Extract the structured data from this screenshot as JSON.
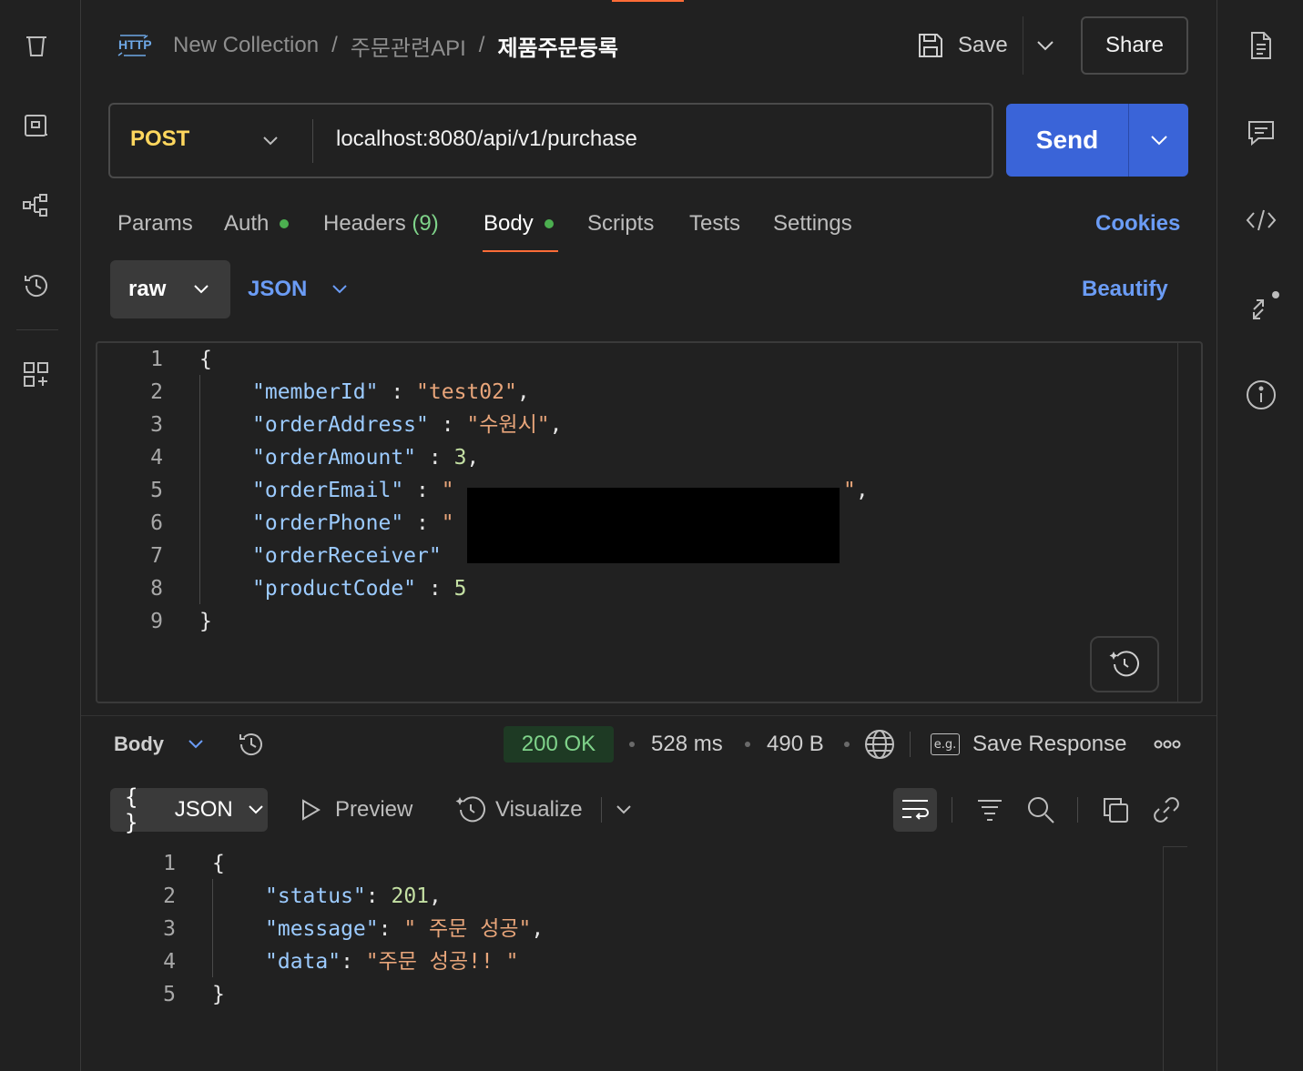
{
  "header": {
    "breadcrumb": [
      "New Collection",
      "주문관련API"
    ],
    "separator": "/",
    "current_request": "제품주문등록",
    "http_badge": "HTTP",
    "save_label": "Save",
    "share_label": "Share"
  },
  "request": {
    "method": "POST",
    "url": "localhost:8080/api/v1/purchase",
    "send_label": "Send"
  },
  "tabs": [
    {
      "label": "Params",
      "dot": false
    },
    {
      "label": "Auth",
      "dot": true
    },
    {
      "label": "Headers",
      "count": "(9)",
      "dot": false
    },
    {
      "label": "Body",
      "dot": true,
      "active": true
    },
    {
      "label": "Scripts",
      "dot": false
    },
    {
      "label": "Tests",
      "dot": false
    },
    {
      "label": "Settings",
      "dot": false
    }
  ],
  "cookies_label": "Cookies",
  "body_mode": {
    "mode": "raw",
    "language": "JSON",
    "beautify_label": "Beautify"
  },
  "request_body": {
    "line_numbers": [
      "1",
      "2",
      "3",
      "4",
      "5",
      "6",
      "7",
      "8",
      "9"
    ],
    "lines": {
      "l1": "{",
      "l2_key": "\"memberId\"",
      "l2_sep": " : ",
      "l2_val": "\"test02\"",
      "l2_end": ",",
      "l3_key": "\"orderAddress\"",
      "l3_sep": " : ",
      "l3_val": "\"수원시\"",
      "l3_end": ",",
      "l4_key": "\"orderAmount\"",
      "l4_sep": " : ",
      "l4_val": "3",
      "l4_end": ",",
      "l5_key": "\"orderEmail\"",
      "l5_sep": " : ",
      "l5_val_open": "\"",
      "l5_val_close": "\"",
      "l5_end": ",",
      "l6_key": "\"orderPhone\"",
      "l6_sep": " : ",
      "l6_val_open": "\"",
      "l7_key": "\"orderReceiver\"",
      "l8_key": "\"productCode\"",
      "l8_sep": " : ",
      "l8_val": "5",
      "l9": "}"
    }
  },
  "response": {
    "body_label": "Body",
    "status": "200 OK",
    "time": "528 ms",
    "size": "490 B",
    "save_response_label": "Save Response",
    "eg_badge": "e.g.",
    "format": "JSON",
    "braces": "{ }",
    "preview_label": "Preview",
    "visualize_label": "Visualize",
    "line_numbers": [
      "1",
      "2",
      "3",
      "4",
      "5"
    ],
    "lines": {
      "l1": "{",
      "l2_key": "\"status\"",
      "l2_sep": ": ",
      "l2_val": "201",
      "l2_end": ",",
      "l3_key": "\"message\"",
      "l3_sep": ": ",
      "l3_val": "\" 주문 성공\"",
      "l3_end": ",",
      "l4_key": "\"data\"",
      "l4_sep": ": ",
      "l4_val": "\"주문 성공!! \"",
      "l5": "}"
    }
  },
  "colors": {
    "accent_orange": "#ff6c37",
    "send_blue": "#3a64d8",
    "link_blue": "#6b9cf5",
    "method_yellow": "#ffd75e",
    "status_green": "#7fd38a",
    "json_key": "#9ccbff",
    "json_string": "#e8a57a",
    "json_number": "#c4e0a3"
  },
  "icons": {
    "left_sidebar": [
      "trash-icon",
      "environment-icon",
      "flows-icon",
      "history-icon",
      "add-workspace-icon"
    ],
    "right_sidebar": [
      "docs-icon",
      "comments-icon",
      "code-icon",
      "related-icon",
      "info-icon"
    ]
  }
}
